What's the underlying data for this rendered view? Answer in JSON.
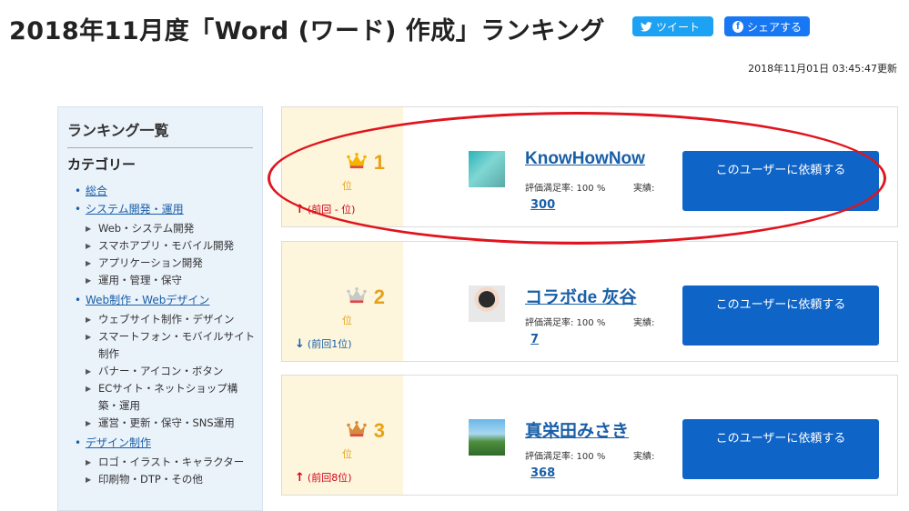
{
  "header": {
    "title": "2018年11月度「Word (ワード) 作成」ランキング",
    "tweet_label": "ツイート",
    "share_label": "シェアする",
    "updated": "2018年11月01日 03:45:47更新"
  },
  "sidebar": {
    "heading": "ランキング一覧",
    "category_heading": "カテゴリー",
    "categories": [
      {
        "label": "総合",
        "subs": []
      },
      {
        "label": "システム開発・運用",
        "subs": [
          "Web・システム開発",
          "スマホアプリ・モバイル開発",
          "アプリケーション開発",
          "運用・管理・保守"
        ]
      },
      {
        "label": "Web制作・Webデザイン",
        "subs": [
          "ウェブサイト制作・デザイン",
          "スマートフォン・モバイルサイト制作",
          "バナー・アイコン・ボタン",
          "ECサイト・ネットショップ構築・運用",
          "運営・更新・保守・SNS運用"
        ]
      },
      {
        "label": "デザイン制作",
        "subs": [
          "ロゴ・イラスト・キャラクター",
          "印刷物・DTP・その他"
        ]
      }
    ]
  },
  "rankings": [
    {
      "rank": "1",
      "unit": "位",
      "prev": "(前回 - 位)",
      "prev_dir": "up",
      "name": "KnowHowNow",
      "rating": "評価満足率: 100 %",
      "perf_label": "実績:",
      "perf_value": "300",
      "button": "このユーザーに依頼する",
      "crown_color": "#f5b400"
    },
    {
      "rank": "2",
      "unit": "位",
      "prev": "(前回1位)",
      "prev_dir": "down",
      "name": "コラボde 灰谷",
      "rating": "評価満足率: 100 %",
      "perf_label": "実績:",
      "perf_value": "7",
      "button": "このユーザーに依頼する",
      "crown_color": "#c8c8c8"
    },
    {
      "rank": "3",
      "unit": "位",
      "prev": "(前回8位)",
      "prev_dir": "up",
      "name": "真栄田みさき",
      "rating": "評価満足率: 100 %",
      "perf_label": "実績:",
      "perf_value": "368",
      "button": "このユーザーに依頼する",
      "crown_color": "#d98a3a"
    }
  ],
  "colors": {
    "accent": "#0f64c8",
    "link": "#1a5fa8",
    "rank": "#e8a117",
    "annotation": "#e0141e",
    "tweet": "#1da1f2",
    "facebook": "#1877f2"
  },
  "icons": {
    "tweet": "twitter-bird-icon",
    "share": "facebook-icon",
    "crown": "crown-icon",
    "up": "arrow-up-icon",
    "down": "arrow-down-icon"
  }
}
